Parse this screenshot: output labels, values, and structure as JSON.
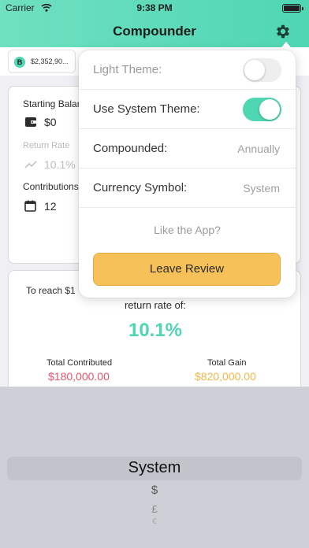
{
  "status_bar": {
    "carrier": "Carrier",
    "time": "9:38 PM"
  },
  "header": {
    "title": "Compounder"
  },
  "tab_strip": {
    "chip_badge": "B",
    "chip_text": "$2,352,90..."
  },
  "inputs_card": {
    "starting_balance_label": "Starting Balan",
    "starting_balance_value": "$0",
    "return_rate_label": "Return Rate",
    "return_rate_value": "10.1%",
    "contributions_label": "Contributions",
    "contributions_value": "12"
  },
  "result_card": {
    "reach_text": "To reach $1",
    "return_rate_label": "return rate of:",
    "return_rate_value": "10.1%",
    "total_contributed_label": "Total Contributed",
    "total_contributed_value": "$180,000.00",
    "total_gain_label": "Total Gain",
    "total_gain_value": "$820,000.00"
  },
  "settings_popover": {
    "light_theme_label": "Light Theme:",
    "light_theme_on": false,
    "system_theme_label": "Use System Theme:",
    "system_theme_on": true,
    "compounded_label": "Compounded:",
    "compounded_value": "Annually",
    "currency_label": "Currency Symbol:",
    "currency_value": "System",
    "like_text": "Like the App?",
    "review_button": "Leave Review"
  },
  "currency_picker": {
    "selected": "System",
    "options": [
      "$",
      "£",
      "€"
    ]
  },
  "colors": {
    "accent": "#4fd6b3",
    "contributed": "#e8536b",
    "gain": "#f2b64a",
    "review_button": "#f7c15a"
  },
  "icons": [
    "wifi-icon",
    "battery-icon",
    "gear-icon",
    "wallet-icon",
    "trend-icon",
    "calendar-icon"
  ]
}
